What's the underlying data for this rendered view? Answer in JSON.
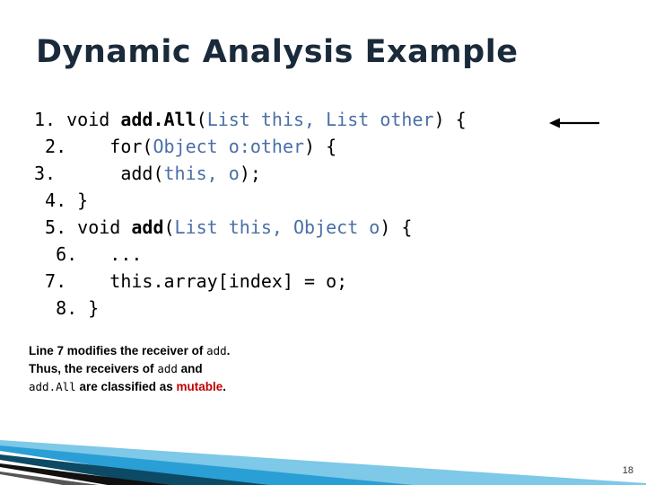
{
  "slide": {
    "title": "Dynamic Analysis Example",
    "page_number": "18",
    "accent_color": "#2a9fd6",
    "title_color": "#1a2a3a",
    "mutable_color": "#c00000",
    "type_color": "#4a6fa5"
  },
  "code": {
    "lines": [
      {
        "number": "1.",
        "segments": [
          {
            "text": " void ",
            "style": "plain"
          },
          {
            "text": "add.All",
            "style": "bold"
          },
          {
            "text": "(",
            "style": "plain"
          },
          {
            "text": "List this, List other",
            "style": "type"
          },
          {
            "text": ") {",
            "style": "plain"
          }
        ]
      },
      {
        "number": " 2.",
        "segments": [
          {
            "text": "    for(",
            "style": "plain"
          },
          {
            "text": "Object o:other",
            "style": "type"
          },
          {
            "text": ") {",
            "style": "plain"
          }
        ]
      },
      {
        "number": "3.",
        "segments": [
          {
            "text": "      add(",
            "style": "plain"
          },
          {
            "text": "this, o",
            "style": "type"
          },
          {
            "text": ");",
            "style": "plain"
          }
        ]
      },
      {
        "number": " 4.",
        "segments": [
          {
            "text": " }",
            "style": "plain"
          }
        ]
      },
      {
        "number": " 5.",
        "segments": [
          {
            "text": " void ",
            "style": "plain"
          },
          {
            "text": "add",
            "style": "bold"
          },
          {
            "text": "(",
            "style": "plain"
          },
          {
            "text": "List this, Object o",
            "style": "type"
          },
          {
            "text": ") {",
            "style": "plain"
          }
        ]
      },
      {
        "number": "  6.",
        "segments": [
          {
            "text": "   ...",
            "style": "plain"
          }
        ]
      },
      {
        "number": " 7.",
        "segments": [
          {
            "text": "    this.array[index] = o;",
            "style": "plain"
          }
        ]
      },
      {
        "number": "  8.",
        "segments": [
          {
            "text": " }",
            "style": "plain"
          }
        ]
      }
    ]
  },
  "caption": {
    "line1_a": "Line 7 modifies the receiver of ",
    "line1_mono": "add",
    "line1_b": ".",
    "line2_a": "Thus, the receivers of ",
    "line2_mono": "add",
    "line2_b": " and",
    "line3_mono": "add.All",
    "line3_a": " are classified as ",
    "line3_mutable": "mutable",
    "line3_b": "."
  }
}
